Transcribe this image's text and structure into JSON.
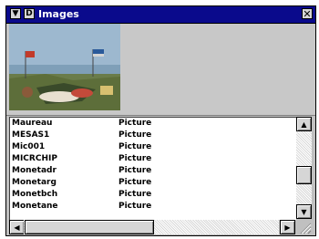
{
  "window": {
    "title": "Images",
    "menu_glyph": "▼",
    "d_glyph": "D",
    "close_glyph": "✕"
  },
  "preview": {
    "image_name": "painting-thumbnail"
  },
  "list": {
    "items": [
      {
        "name": "Maureau",
        "type": "Picture"
      },
      {
        "name": "MESAS1",
        "type": "Picture"
      },
      {
        "name": "Mic001",
        "type": "Picture"
      },
      {
        "name": "MICRCHIP",
        "type": "Picture"
      },
      {
        "name": "Monetadr",
        "type": "Picture"
      },
      {
        "name": "Monetarg",
        "type": "Picture"
      },
      {
        "name": "Monetbch",
        "type": "Picture"
      },
      {
        "name": "Monetane",
        "type": "Picture"
      }
    ]
  },
  "scrollbar": {
    "up_glyph": "▲",
    "down_glyph": "▼",
    "left_glyph": "◀",
    "right_glyph": "▶"
  }
}
